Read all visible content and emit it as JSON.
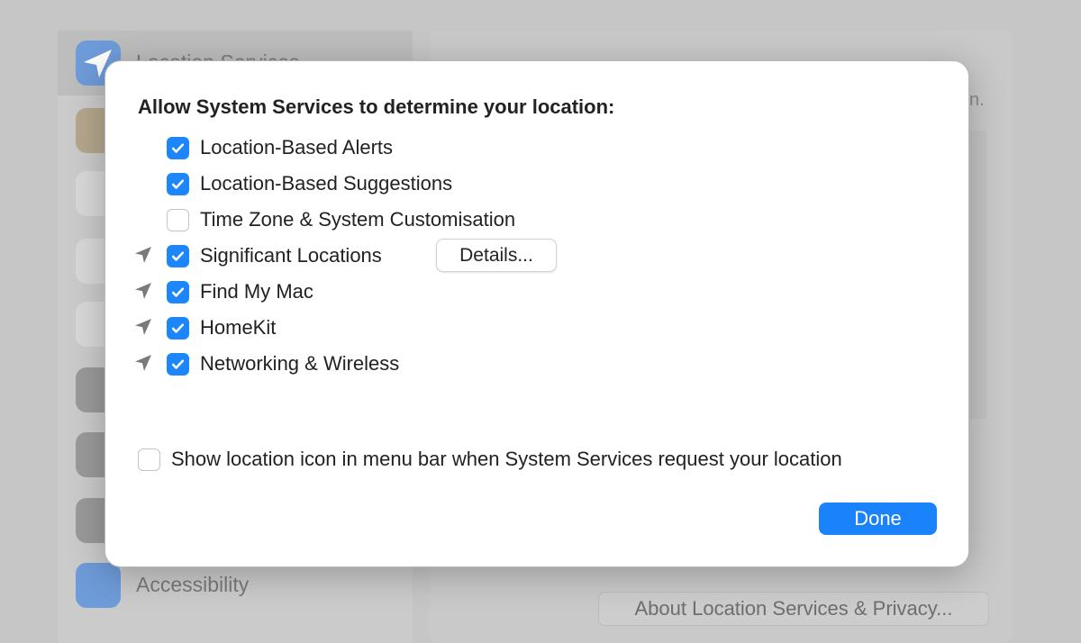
{
  "background": {
    "sidebar": {
      "items": [
        {
          "label": "Location Services",
          "icon": "location-arrow-icon",
          "color": "#6e9bd9"
        },
        {
          "label": "",
          "icon": "contacts-icon",
          "color": "#b5a78e"
        },
        {
          "label": "",
          "icon": "calendar-icon",
          "color": "#d8d8d8"
        },
        {
          "label": "",
          "icon": "reminders-icon",
          "color": "#d8d8d8"
        },
        {
          "label": "",
          "icon": "photos-icon",
          "color": "#d8d8d8"
        },
        {
          "label": "",
          "icon": "camera-icon",
          "color": "#9a9a9a"
        },
        {
          "label": "",
          "icon": "microphone-icon",
          "color": "#9a9a9a"
        },
        {
          "label": "",
          "icon": "speech-recognition-icon",
          "color": "#9a9a9a"
        },
        {
          "label": "Accessibility",
          "icon": "accessibility-icon",
          "color": "#6e9bd9"
        }
      ]
    },
    "about_button": "About Location Services & Privacy..."
  },
  "dialog": {
    "heading": "Allow System Services to determine your location:",
    "items": [
      {
        "label": "Location-Based Alerts",
        "checked": true,
        "location_icon": false
      },
      {
        "label": "Location-Based Suggestions",
        "checked": true,
        "location_icon": false
      },
      {
        "label": "Time Zone & System Customisation",
        "checked": false,
        "location_icon": false
      },
      {
        "label": "Significant Locations",
        "checked": true,
        "location_icon": true
      },
      {
        "label": "Find My Mac",
        "checked": true,
        "location_icon": true
      },
      {
        "label": "HomeKit",
        "checked": true,
        "location_icon": true
      },
      {
        "label": "Networking & Wireless",
        "checked": true,
        "location_icon": true
      }
    ],
    "details_button": "Details...",
    "menu_bar_option": {
      "label": "Show location icon in menu bar when System Services request your location",
      "checked": false
    },
    "done_button": "Done",
    "accent_color": "#1a82fb"
  }
}
